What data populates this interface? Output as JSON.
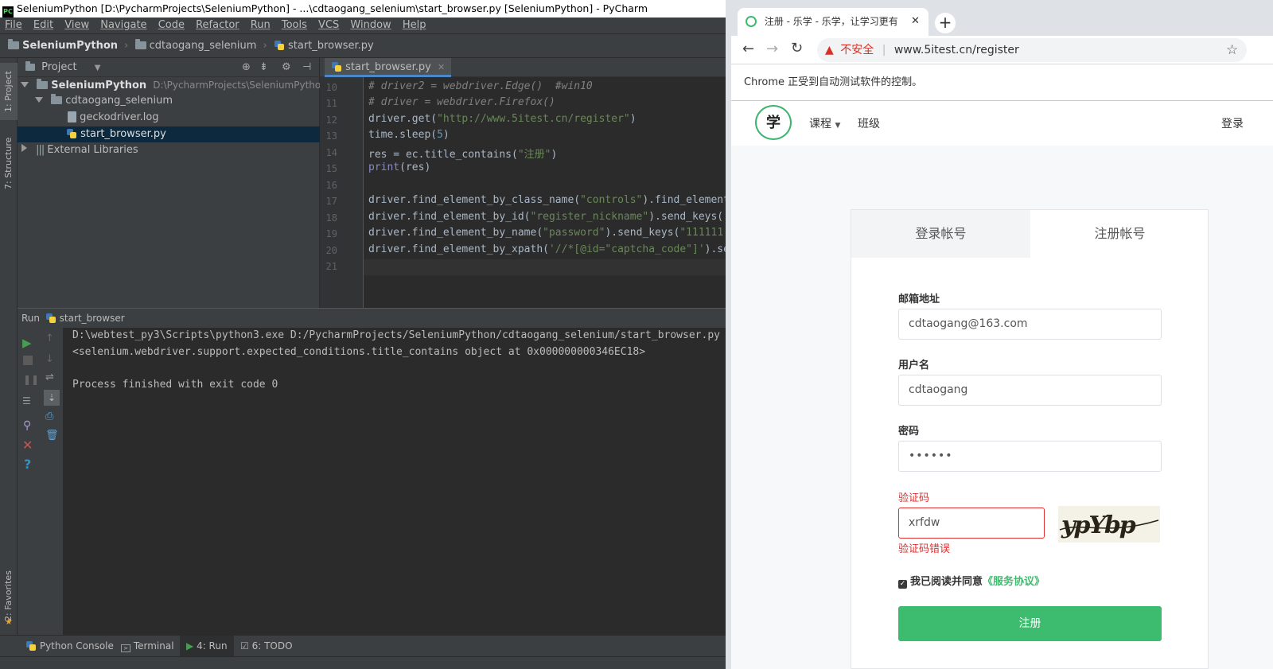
{
  "ide": {
    "title": "SeleniumPython [D:\\PycharmProjects\\SeleniumPython] - ...\\cdtaogang_selenium\\start_browser.py [SeleniumPython] - PyCharm",
    "menu": [
      "File",
      "Edit",
      "View",
      "Navigate",
      "Code",
      "Refactor",
      "Run",
      "Tools",
      "VCS",
      "Window",
      "Help"
    ],
    "breadcrumb": [
      "SeleniumPython",
      "cdtaogang_selenium",
      "start_browser.py"
    ],
    "left_tabs": [
      "1: Project",
      "7: Structure",
      "2: Favorites"
    ],
    "project_panel": {
      "title": "Project",
      "tree": [
        {
          "label": "SeleniumPython",
          "path": "D:\\PycharmProjects\\SeleniumPython"
        },
        {
          "label": "cdtaogang_selenium"
        },
        {
          "label": "geckodriver.log"
        },
        {
          "label": "start_browser.py"
        },
        {
          "label": "External Libraries"
        }
      ]
    },
    "editor": {
      "tab": "start_browser.py",
      "line_numbers": [
        "10",
        "11",
        "12",
        "13",
        "14",
        "15",
        "16",
        "17",
        "18",
        "19",
        "20",
        "21"
      ],
      "lines": {
        "l10": "# driver2 = webdriver.Edge()  #win10",
        "l11": "# driver = webdriver.Firefox()",
        "l12a": "driver.get(",
        "l12b": "\"http://www.5itest.cn/register\"",
        "l12c": ")",
        "l13a": "time.sleep(",
        "l13b": "5",
        "l13c": ")",
        "l14a": "res = ec.title_contains(",
        "l14b": "\"注册\"",
        "l14c": ")",
        "l15a": "print",
        "l15b": "(res)",
        "l17a": "driver.find_element_by_class_name(",
        "l17b": "\"controls\"",
        "l17c": ").find_element",
        "l18a": "driver.find_element_by_id(",
        "l18b": "\"register_nickname\"",
        "l18c": ").send_keys(",
        "l19a": "driver.find_element_by_name(",
        "l19b": "\"password\"",
        "l19c": ").send_keys(",
        "l19d": "\"111111",
        "l20a": "driver.find_element_by_xpath(",
        "l20b": "'//*[@id=\"captcha_code\"]'",
        "l20c": ").se"
      }
    },
    "run": {
      "header_label": "Run",
      "config": "start_browser",
      "output": [
        "D:\\webtest_py3\\Scripts\\python3.exe D:/PycharmProjects/SeleniumPython/cdtaogang_selenium/start_browser.py",
        "<selenium.webdriver.support.expected_conditions.title_contains object at 0x000000000346EC18>",
        "",
        "Process finished with exit code 0"
      ]
    },
    "bottom_tabs": {
      "python_console": "Python Console",
      "terminal": "Terminal",
      "run": "4: Run",
      "todo": "6: TODO"
    },
    "colors": {
      "run_green": "#499c54",
      "stop_red": "#c75450",
      "help_blue": "#3592c4"
    }
  },
  "browser": {
    "tab_title": "注册 - 乐学 - 乐学，让学习更有",
    "new_tab": "+",
    "insecure_label": "不安全",
    "url": "www.5itest.cn/register",
    "automation_notice": "Chrome 正受到自动测试软件的控制。",
    "site": {
      "logo_text": "学",
      "nav": [
        "课程",
        "班级"
      ],
      "login": "登录",
      "tabs": {
        "login": "登录帐号",
        "register": "注册帐号"
      },
      "form": {
        "email_label": "邮箱地址",
        "email_value": "cdtaogang@163.com",
        "username_label": "用户名",
        "username_value": "cdtaogang",
        "password_label": "密码",
        "password_value": "••••••",
        "captcha_label": "验证码",
        "captcha_value": "xrfdw",
        "captcha_image_text": "ypYbp",
        "captcha_error": "验证码错误",
        "agree_text": "我已阅读并同意",
        "agree_link": "《服务协议》",
        "submit": "注册"
      }
    },
    "colors": {
      "accent_green": "#3dbb6e",
      "error_red": "#e03030",
      "warning_red": "#d93025"
    }
  }
}
